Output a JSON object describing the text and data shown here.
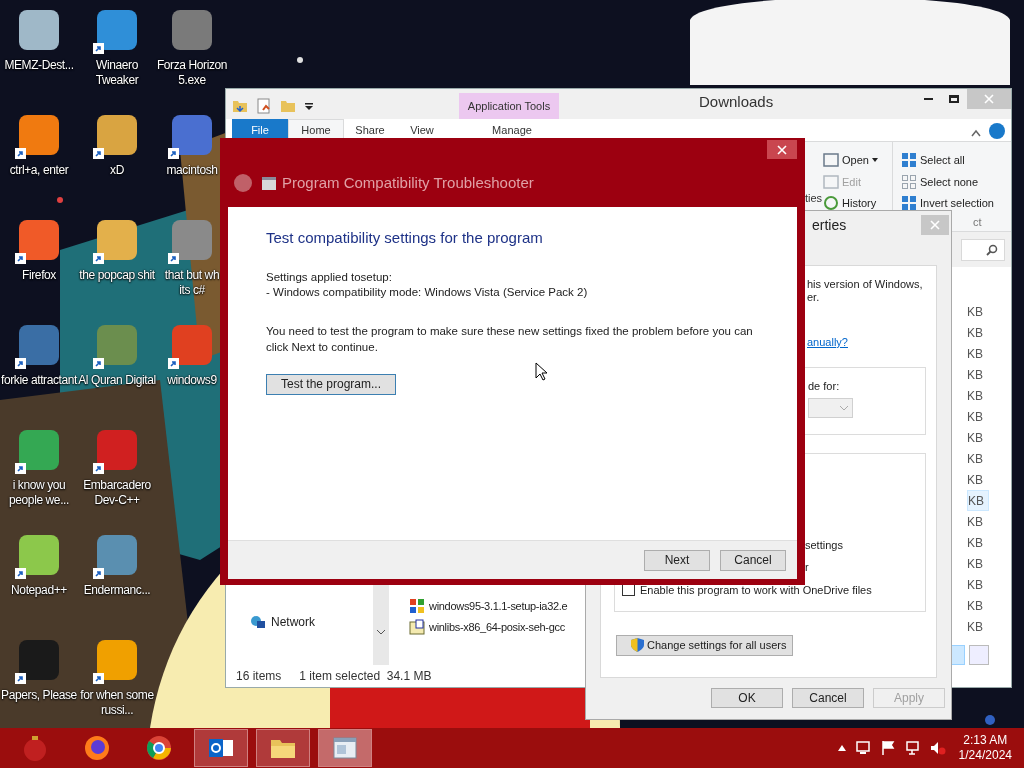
{
  "desktop_icons": [
    {
      "label": "MEMZ-Dest...",
      "color": "#9fb8c8",
      "shortcut": false
    },
    {
      "label": "ctrl+a, enter",
      "color": "#f07a10",
      "shortcut": true
    },
    {
      "label": "Firefox",
      "color": "#f05a28",
      "shortcut": true
    },
    {
      "label": "forkie attractant",
      "color": "#3a6ea5",
      "shortcut": true
    },
    {
      "label": "i know you people we...",
      "color": "#34a853",
      "shortcut": true
    },
    {
      "label": "Notepad++",
      "color": "#8cc84b",
      "shortcut": true
    },
    {
      "label": "Papers, Please",
      "color": "#1a1a1a",
      "shortcut": true
    },
    {
      "label": "Winaero Tweaker",
      "color": "#2f8fd8",
      "shortcut": true
    },
    {
      "label": "xD",
      "color": "#d9a441",
      "shortcut": true
    },
    {
      "label": "the popcap shit",
      "color": "#e3b04b",
      "shortcut": true
    },
    {
      "label": "Al Quran Digital",
      "color": "#6b8e4e",
      "shortcut": true
    },
    {
      "label": "Embarcadero Dev-C++",
      "color": "#d02020",
      "shortcut": true
    },
    {
      "label": "Endermanc...",
      "color": "#5a8fb0",
      "shortcut": true
    },
    {
      "label": "for when some russi...",
      "color": "#f0a000",
      "shortcut": true
    },
    {
      "label": "Forza Horizon 5.exe",
      "color": "#7a7a7a",
      "shortcut": false
    },
    {
      "label": "macintosh",
      "color": "#4a6fd0",
      "shortcut": true
    },
    {
      "label": "that but wh\nits c#",
      "color": "#8a8a8a",
      "shortcut": true
    },
    {
      "label": "windows9",
      "color": "#e04020",
      "shortcut": true
    }
  ],
  "explorer": {
    "title": "Downloads",
    "context_tab": "Application Tools",
    "tabs": [
      {
        "label": "File",
        "kind": "file",
        "selected": false
      },
      {
        "label": "Home",
        "kind": "tab",
        "selected": true
      },
      {
        "label": "Share",
        "kind": "tab",
        "selected": false
      },
      {
        "label": "View",
        "kind": "tab",
        "selected": false
      },
      {
        "label": "Manage",
        "kind": "tab",
        "selected": false
      }
    ],
    "ribbon_cut_label": "ties",
    "open_group": [
      {
        "label": "Open",
        "kind": "open",
        "disabled": false
      },
      {
        "label": "Edit",
        "kind": "edit",
        "disabled": true
      },
      {
        "label": "History",
        "kind": "history",
        "disabled": false
      }
    ],
    "select_group": [
      {
        "label": "Select all",
        "kind": "all"
      },
      {
        "label": "Select none",
        "kind": "none"
      },
      {
        "label": "Invert selection",
        "kind": "invert"
      }
    ],
    "select_group_label": "ct",
    "nav": [
      {
        "label": "Network"
      }
    ],
    "rows": [
      {
        "size": "KB",
        "selected": false
      },
      {
        "size": "KB",
        "selected": false
      },
      {
        "size": "KB",
        "selected": false
      },
      {
        "size": "KB",
        "selected": false
      },
      {
        "size": "KB",
        "selected": false
      },
      {
        "size": "KB",
        "selected": false
      },
      {
        "size": "KB",
        "selected": false
      },
      {
        "size": "KB",
        "selected": false
      },
      {
        "size": "KB",
        "selected": false
      },
      {
        "size": "KB",
        "selected": true
      },
      {
        "size": "KB",
        "selected": false
      },
      {
        "size": "KB",
        "selected": false
      },
      {
        "size": "KB",
        "selected": false
      },
      {
        "size": "KB",
        "selected": false
      },
      {
        "name": "windows95-3.1.1-setup-ia32.e",
        "kind": "windows",
        "size": "KB",
        "selected": false
      },
      {
        "name": "winlibs-x86_64-posix-seh-gcc",
        "kind": "unknown",
        "size": "KB",
        "selected": false
      }
    ],
    "status": {
      "count": "16 items",
      "selection": "1 item selected  34.1 MB"
    }
  },
  "properties": {
    "title": "erties",
    "lines": [
      "his version of Windows,",
      "er."
    ],
    "link": "anually?",
    "mode_label": "de for:",
    "mode_dropdown_disabled": true,
    "settings_lines": [
      "settings",
      "r"
    ],
    "checkbox": {
      "label": "Enable this program to work with OneDrive files",
      "checked": false
    },
    "all_users_button": "Change settings for all users",
    "buttons": [
      {
        "label": "OK",
        "disabled": false
      },
      {
        "label": "Cancel",
        "disabled": false
      },
      {
        "label": "Apply",
        "disabled": true
      }
    ]
  },
  "troubleshooter": {
    "title": "Program Compatibility Troubleshooter",
    "heading": "Test compatibility settings for the program",
    "applied": [
      "Settings applied tosetup:",
      "- Windows compatibility mode: Windows Vista (Service Pack 2)"
    ],
    "instruction": "You need to test the program to make sure these new settings fixed the problem before you can click Next to continue.",
    "test_button": "Test the program...",
    "buttons": [
      "Next",
      "Cancel"
    ]
  },
  "taskbar": {
    "items": [
      {
        "kind": "ornament",
        "selected": false,
        "open": false
      },
      {
        "kind": "fox",
        "selected": false,
        "open": false
      },
      {
        "kind": "wheel",
        "selected": false,
        "open": false
      },
      {
        "kind": "mail",
        "selected": false,
        "open": true
      },
      {
        "kind": "folder",
        "selected": false,
        "open": true
      },
      {
        "kind": "window",
        "selected": true,
        "open": true
      }
    ],
    "time": "2:13 AM",
    "date": "1/24/2024"
  }
}
